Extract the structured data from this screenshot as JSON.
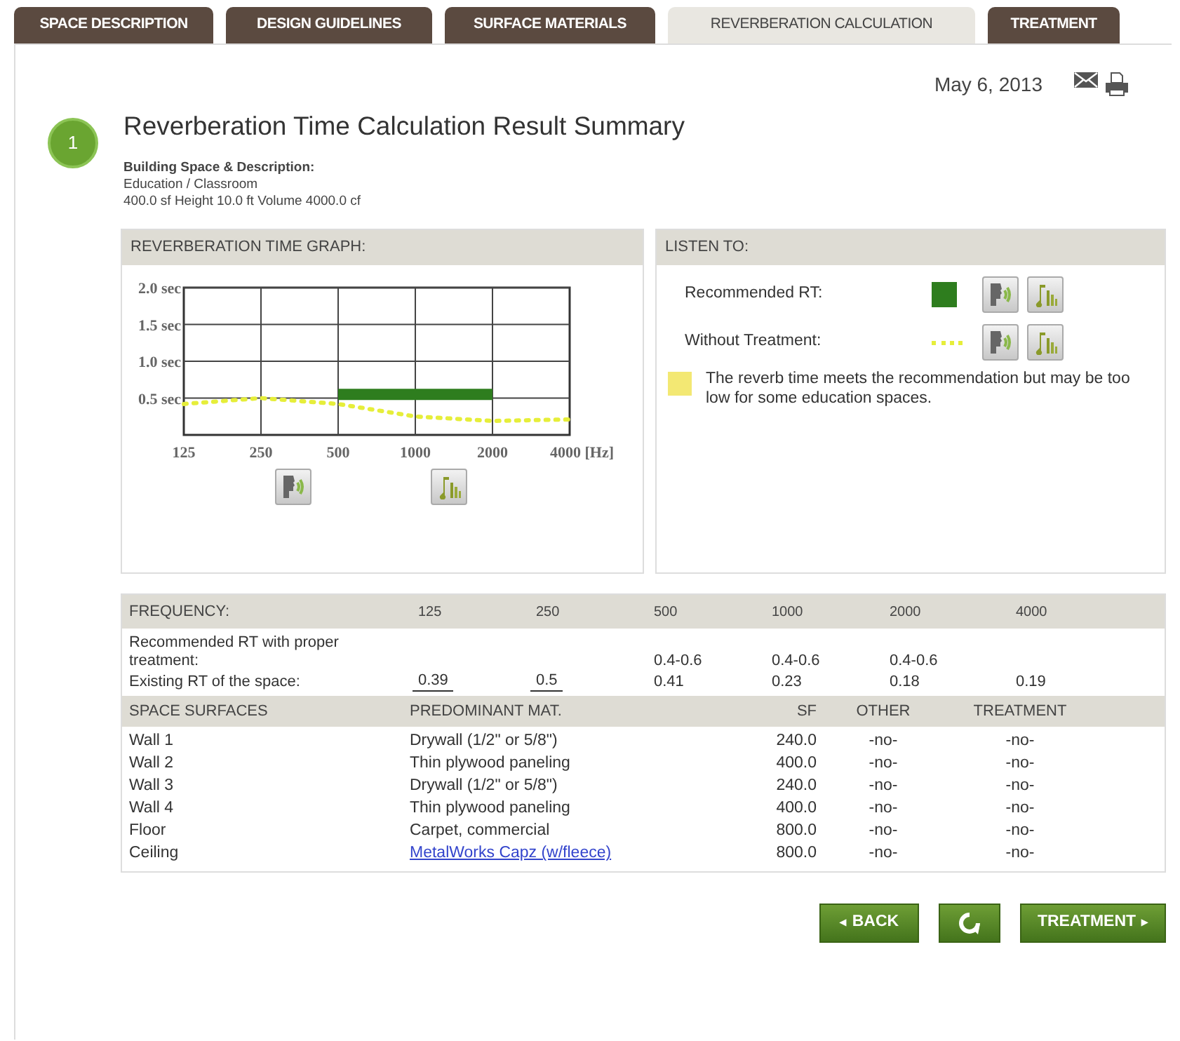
{
  "tabs": [
    {
      "label": "SPACE DESCRIPTION",
      "selected": false
    },
    {
      "label": "DESIGN GUIDELINES",
      "selected": false
    },
    {
      "label": "SURFACE MATERIALS",
      "selected": false
    },
    {
      "label": "REVERBERATION CALCULATION",
      "selected": true
    },
    {
      "label": "TREATMENT",
      "selected": false
    }
  ],
  "date": "May 6, 2013",
  "step": "1",
  "title": "Reverberation Time Calculation Result Summary",
  "building": {
    "heading": "Building Space & Description:",
    "type": "Education / Classroom",
    "dimensions": "400.0 sf Height 10.0 ft Volume 4000.0 cf"
  },
  "graph_panel": {
    "heading": "REVERBERATION TIME GRAPH:",
    "chart_data": {
      "type": "line",
      "grid": true,
      "categories": [
        "125",
        "250",
        "500",
        "1000",
        "2000",
        "4000 [Hz]"
      ],
      "ylim": [
        0,
        2
      ],
      "yticks": [
        {
          "value": 0.5,
          "label": "0.5 sec"
        },
        {
          "value": 1,
          "label": "1.0 sec"
        },
        {
          "value": 1.5,
          "label": "1.5 sec"
        },
        {
          "value": 2,
          "label": "2.0 sec"
        }
      ],
      "series": [
        {
          "color": "#2e7d1e",
          "line_style": "solid",
          "values": [
            null,
            null,
            0.55,
            0.55,
            0.55,
            null
          ]
        },
        {
          "color": "#e6ee3a",
          "line_style": "dotted",
          "values": [
            0.42,
            0.5,
            0.42,
            0.25,
            0.19,
            0.21
          ]
        }
      ]
    }
  },
  "listen_panel": {
    "heading": "LISTEN TO:",
    "items": [
      {
        "label": "Recommended RT:",
        "kind": "solid",
        "color": "#2e7d1e"
      },
      {
        "label": "Without Treatment:",
        "kind": "dotted",
        "color": "#e6ee3a"
      }
    ],
    "note": {
      "color": "#f3e873",
      "text": "The reverb time meets the recommendation but may be too low for some education spaces."
    }
  },
  "frequency_table": {
    "columns": [
      "FREQUENCY:",
      "125",
      "250",
      "500",
      "1000",
      "2000",
      "4000"
    ],
    "rows": [
      {
        "cells": [
          {
            "text": "Recommended RT with proper treatment:",
            "editable": false
          },
          {
            "text": "",
            "editable": false
          },
          {
            "text": "",
            "editable": false
          },
          {
            "text": "0.4-0.6",
            "editable": false
          },
          {
            "text": "0.4-0.6",
            "editable": false
          },
          {
            "text": "0.4-0.6",
            "editable": false
          },
          {
            "text": "",
            "editable": false
          }
        ]
      },
      {
        "cells": [
          {
            "text": "Existing RT of the space:",
            "editable": false
          },
          {
            "text": "0.39",
            "editable": true
          },
          {
            "text": "0.5",
            "editable": true
          },
          {
            "text": "0.41",
            "editable": false
          },
          {
            "text": "0.23",
            "editable": false
          },
          {
            "text": "0.18",
            "editable": false
          },
          {
            "text": "0.19",
            "editable": false
          }
        ]
      }
    ]
  },
  "surfaces_table": {
    "columns": [
      "SPACE SURFACES",
      "PREDOMINANT MAT.",
      "SF",
      "OTHER",
      "TREATMENT"
    ],
    "rows": [
      {
        "surface": "Wall 1",
        "material": "Drywall (1/2\" or 5/8\")",
        "link": false,
        "sf": "240.0",
        "other": "-no-",
        "treatment": "-no-"
      },
      {
        "surface": "Wall 2",
        "material": "Thin plywood paneling",
        "link": false,
        "sf": "400.0",
        "other": "-no-",
        "treatment": "-no-"
      },
      {
        "surface": "Wall 3",
        "material": "Drywall (1/2\" or 5/8\")",
        "link": false,
        "sf": "240.0",
        "other": "-no-",
        "treatment": "-no-"
      },
      {
        "surface": "Wall 4",
        "material": "Thin plywood paneling",
        "link": false,
        "sf": "400.0",
        "other": "-no-",
        "treatment": "-no-"
      },
      {
        "surface": "Floor",
        "material": "Carpet, commercial",
        "link": false,
        "sf": "800.0",
        "other": "-no-",
        "treatment": "-no-"
      },
      {
        "surface": "Ceiling",
        "material": "MetalWorks Capz (w/fleece)",
        "link": true,
        "sf": "800.0",
        "other": "-no-",
        "treatment": "-no-"
      }
    ]
  },
  "buttons": [
    {
      "kind": "back",
      "label": "BACK",
      "arrow": "◂"
    },
    {
      "kind": "refresh"
    },
    {
      "kind": "next",
      "label": "TREATMENT",
      "arrow": "▸"
    }
  ]
}
